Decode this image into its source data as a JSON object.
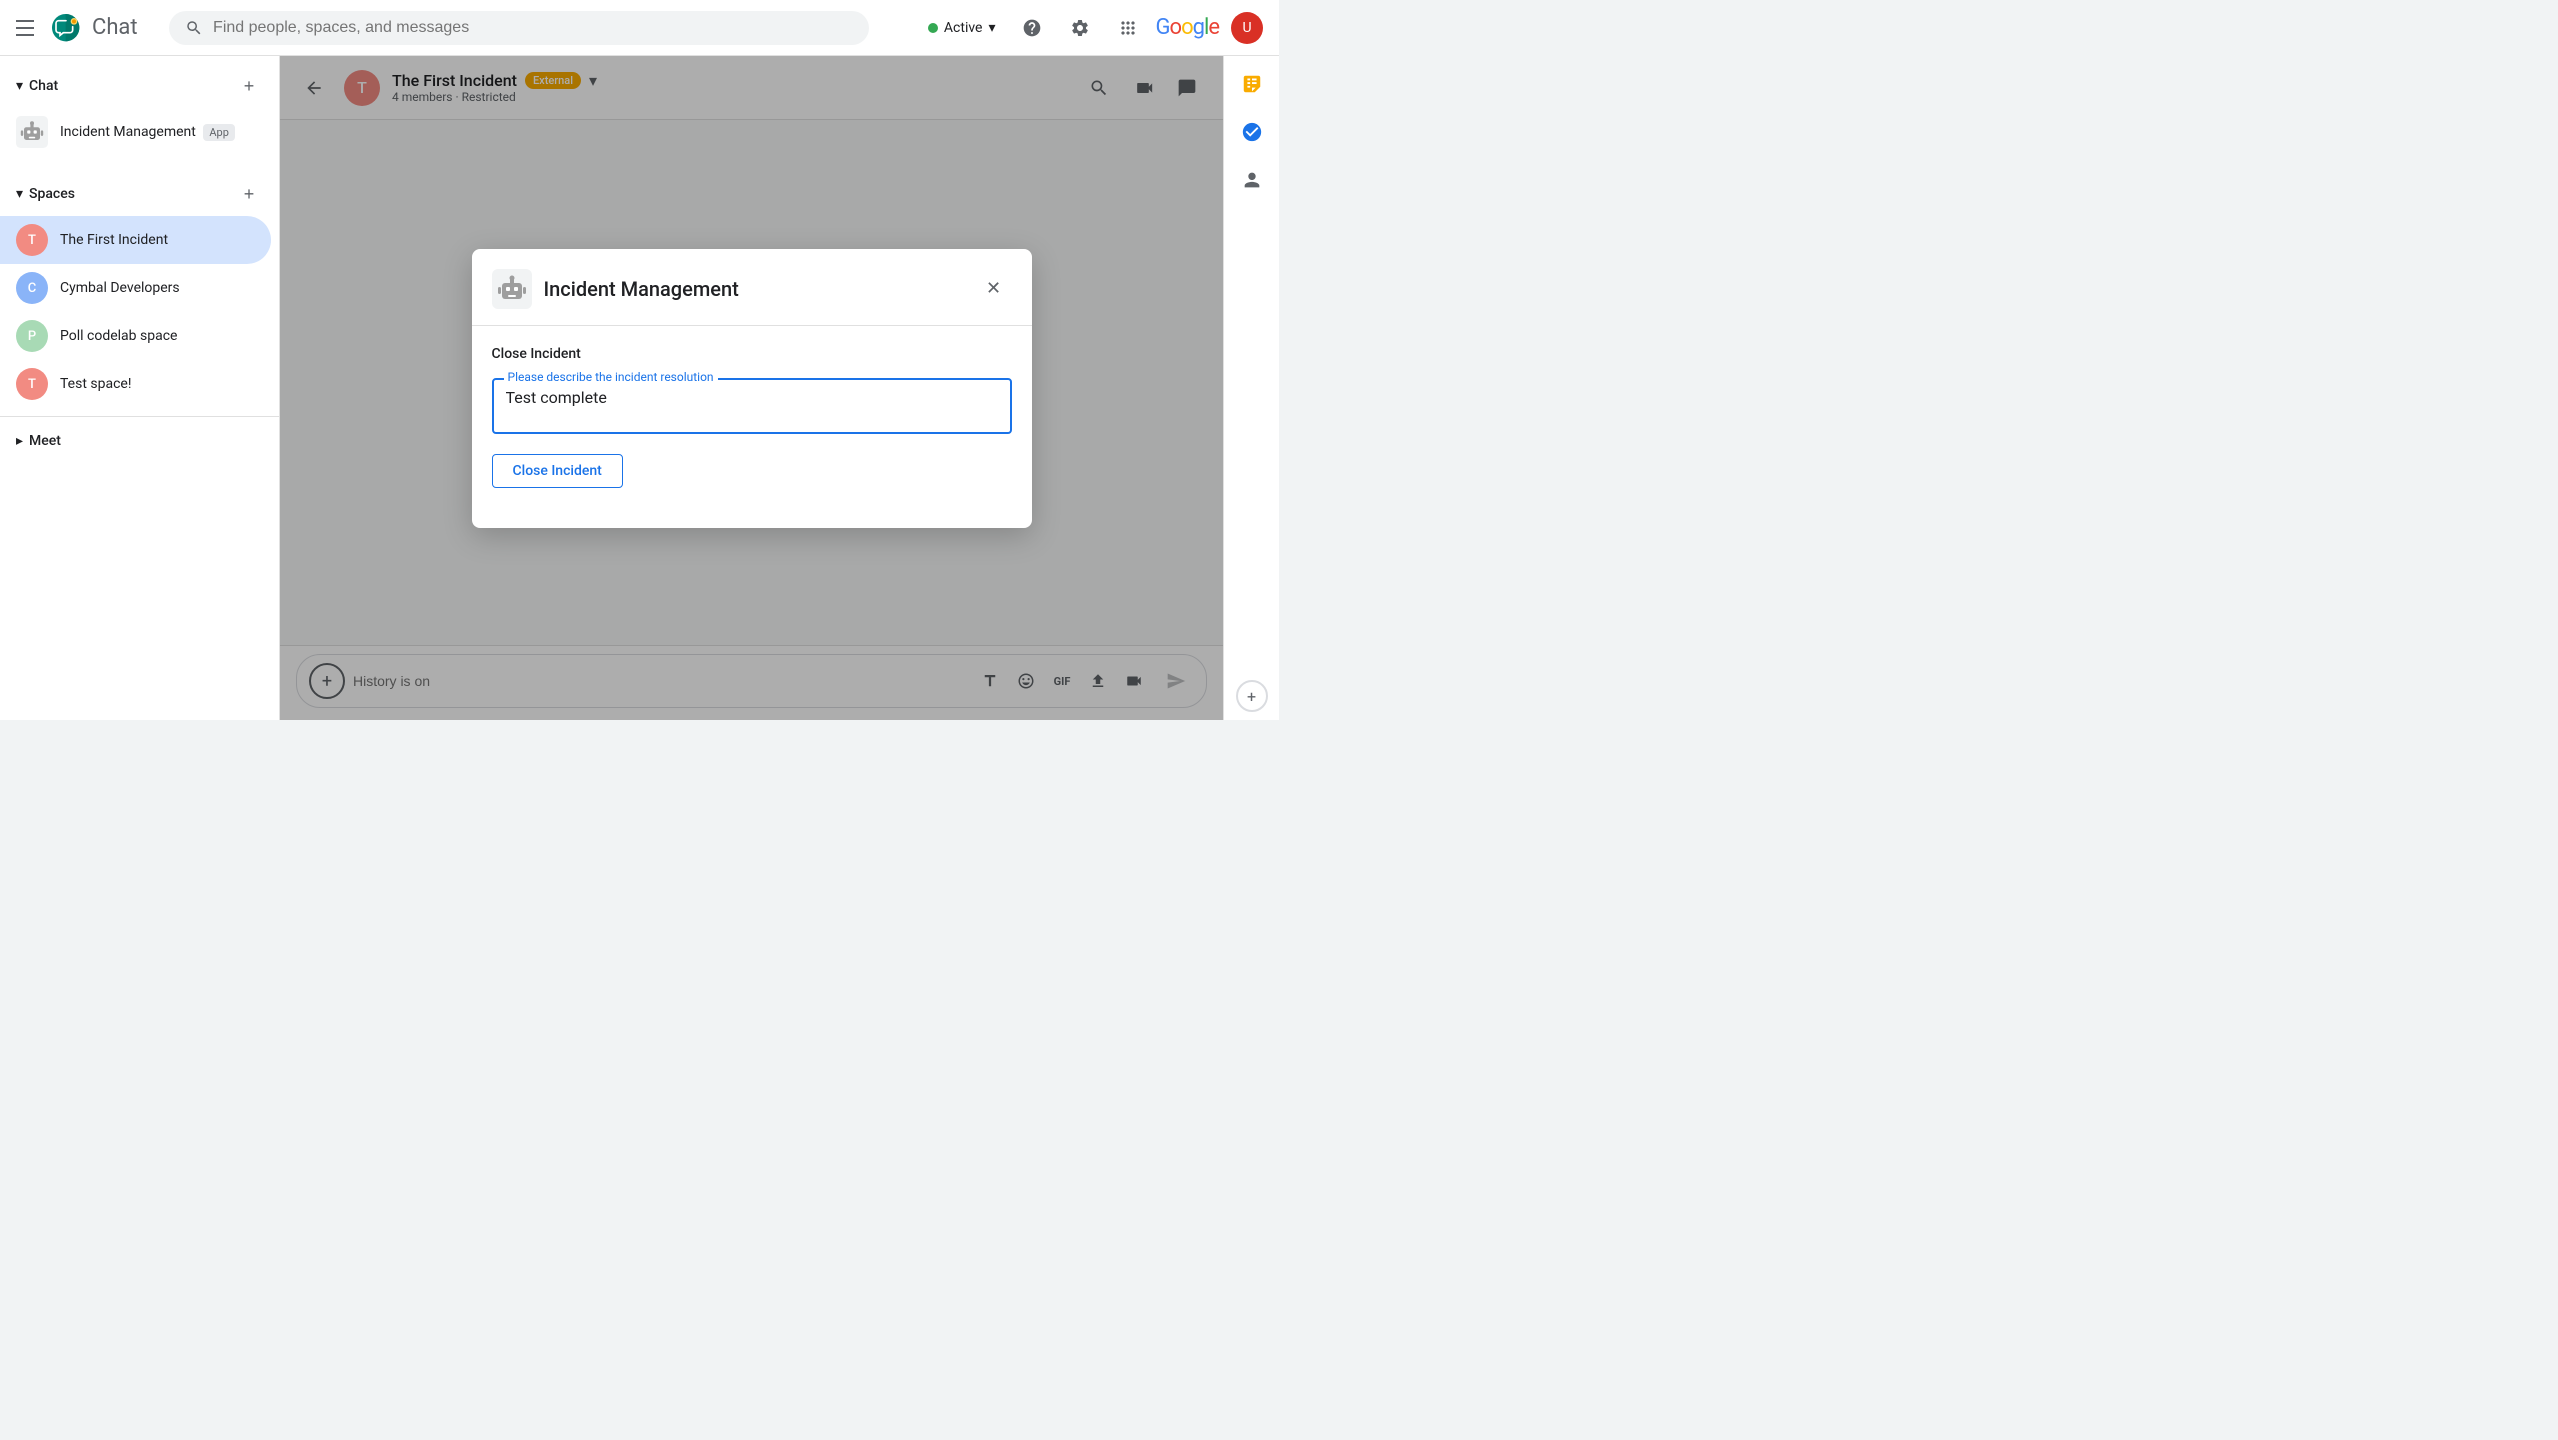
{
  "topbar": {
    "app_title": "Chat",
    "search_placeholder": "Find people, spaces, and messages",
    "active_label": "Active",
    "active_dropdown": "▾",
    "google_logo": "Google",
    "help_icon": "?",
    "settings_icon": "⚙",
    "grid_icon": "⋮⋮⋮"
  },
  "sidebar": {
    "chat_section_title": "Chat",
    "chat_section_collapsed": false,
    "chat_items": [
      {
        "id": "incident-management",
        "label": "Incident Management",
        "sublabel": "App",
        "avatar_color": "#9e9e9e",
        "avatar_text": ""
      }
    ],
    "spaces_section_title": "Spaces",
    "spaces_items": [
      {
        "id": "the-first-incident",
        "label": "The First Incident",
        "avatar_color": "#f28b82",
        "avatar_text": "T",
        "active": true
      },
      {
        "id": "cymbal-developers",
        "label": "Cymbal Developers",
        "avatar_color": "#8ab4f8",
        "avatar_text": "C",
        "active": false
      },
      {
        "id": "poll-codelab-space",
        "label": "Poll codelab space",
        "avatar_color": "#a8dab5",
        "avatar_text": "P",
        "active": false
      },
      {
        "id": "test-space",
        "label": "Test space!",
        "avatar_color": "#f28b82",
        "avatar_text": "T",
        "active": false
      }
    ],
    "meet_section_title": "Meet",
    "add_label": "+"
  },
  "chat_header": {
    "back_icon": "←",
    "title": "The First Incident",
    "external_badge": "External",
    "dropdown_icon": "▾",
    "subtitle": "4 members · Restricted",
    "search_icon": "🔍",
    "video_icon": "▣",
    "chat_icon": "💬"
  },
  "chat_input": {
    "placeholder": "History is on",
    "plus_icon": "+",
    "format_icon": "A",
    "emoji_icon": "☺",
    "gif_icon": "GIF",
    "upload_icon": "↑",
    "video_call_icon": "⬛",
    "send_icon": "➤"
  },
  "right_panel": {
    "tasks_label": "tasks",
    "plus_icon": "+",
    "person_icon": "person",
    "settings_icon": "settings",
    "check_icon": "✓"
  },
  "modal": {
    "title": "Incident Management",
    "close_icon": "✕",
    "section_title": "Close Incident",
    "field_label": "Please describe the incident resolution",
    "field_value": "Test complete",
    "action_button_label": "Close Incident"
  }
}
